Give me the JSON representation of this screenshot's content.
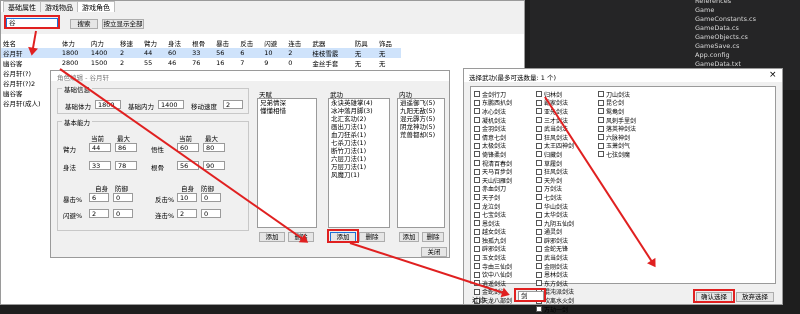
{
  "main": {
    "tabs": [
      "基础属性",
      "游戏物品",
      "游戏角色"
    ],
    "search_value": "谷",
    "search_button": "搜索",
    "show_all_button": "按立显示全部",
    "columns": [
      "姓名",
      "体力",
      "内力",
      "移速",
      "臂力",
      "身法",
      "根骨",
      "暴击",
      "反击",
      "闪避",
      "连击",
      "武器",
      "防具",
      "饰品"
    ],
    "rows": [
      [
        "谷月轩",
        "1800",
        "1400",
        "2",
        "44",
        "60",
        "33",
        "56",
        "6",
        "10",
        "2",
        "桂枝雪霰",
        "无",
        "无"
      ],
      [
        "幽谷客",
        "2800",
        "1500",
        "2",
        "55",
        "46",
        "76",
        "16",
        "7",
        "9",
        "0",
        "金丝手套",
        "无",
        "无"
      ],
      [
        "谷月轩(?)",
        "",
        "",
        "",
        "",
        "",
        "",
        "",
        "",
        "",
        "",
        "",
        "",
        ""
      ],
      [
        "谷月轩(?)2",
        "",
        "",
        "",
        "",
        "",
        "",
        "",
        "",
        "",
        "",
        "",
        "",
        ""
      ],
      [
        "幽谷客",
        "",
        "",
        "",
        "",
        "",
        "",
        "",
        "",
        "",
        "",
        "",
        "",
        ""
      ],
      [
        "谷月轩(成人)",
        "",
        "",
        "",
        "",
        "",
        "",
        "",
        "",
        "",
        "",
        "",
        "",
        ""
      ]
    ]
  },
  "role": {
    "title": "角色编辑 - 谷月轩",
    "basic_info": "基础信息",
    "hp_label": "基础体力",
    "hp": "1800",
    "mp_label": "基础内力",
    "mp": "1400",
    "speed_label": "移动速度",
    "speed": "2",
    "ability": "基本能力",
    "current": "当前",
    "max": "最大",
    "self": "自身",
    "bonus": "防御",
    "stats": [
      {
        "l": "臂力",
        "c": "44",
        "m": "86"
      },
      {
        "l": "悟性",
        "c": "60",
        "m": "80"
      },
      {
        "l": "身法",
        "c": "33",
        "m": "78"
      },
      {
        "l": "根骨",
        "c": "56",
        "m": "90"
      }
    ],
    "crit_label": "暴击%",
    "crit": "6",
    "crit2": "0",
    "counter_label": "反击%",
    "counter": "10",
    "counter2": "0",
    "dodge_label": "闪避%",
    "dodge": "2",
    "dodge2": "0",
    "combo_label": "连击%",
    "combo": "2",
    "combo2": "0",
    "talent_title": "天赋",
    "talents": [
      "兄弟情深",
      "懂懂相惜"
    ],
    "martial_title": "武功",
    "martials": [
      "永诀英雄掌(4)",
      "冰冲落月脚(3)",
      "北汇玄功(2)",
      "画出刀法(1)",
      "血刀狂杀(1)",
      "七杀刀法(1)",
      "断竹刀法(1)",
      "六层刀法(1)",
      "万层刀法(1)",
      "风魔刀(1)"
    ],
    "inner_title": "内功",
    "inners": [
      "逍遥御飞(5)",
      "九阳无敌(5)",
      "混元霹方(5)",
      "阴龙神功(5)",
      "荒兽都却(5)"
    ],
    "add": "添加",
    "delete": "删除",
    "close": "关闭"
  },
  "picker": {
    "title": "选择武功(最多可选数量: 1 个)",
    "close": "×",
    "col1": [
      "金剑行刀",
      "东鹏西扒剑",
      "冰心剑法",
      "凝机剑法",
      "金羽剑法",
      "倩意七剑",
      "太极剑法",
      "倚锋柔剑",
      "视清百春剑",
      "天马百步剑",
      "天山归雁剑",
      "赤血剑刀",
      "天子剑",
      "龙泣剑",
      "七宝剑法",
      "恩剑法",
      "越女剑法",
      "独孤九剑",
      "辟邪剑法",
      "玉女剑法",
      "寺由三仙剑",
      "饮中八仙剑",
      "逍遥剑法",
      "金蛇剑法",
      "天龙八部剑"
    ],
    "col2": [
      "归林剑",
      "霸家剑法",
      "亚先剑法",
      "三才剑法",
      "武当剑法",
      "狂风剑法",
      "太王四神剑",
      "归藏剑",
      "草履剑",
      "狂风剑法",
      "天外剑",
      "万剑法",
      "七剑法",
      "华山剑法",
      "太华剑法",
      "九阴五仙剑",
      "通灵剑",
      "辟邪剑法",
      "金蛇无锋",
      "武当剑法",
      "金刚剑法",
      "恩林剑法",
      "东方剑法",
      "混沌派剑法",
      "坎离水火剑",
      "万劫一剑"
    ],
    "col3": [
      "刀山剑法",
      "昆仑剑",
      "鸳鸯剑",
      "风刺手里剑",
      "落英神剑法",
      "六脉神剑",
      "玉萧剑气",
      "七弦剑魔"
    ],
    "filter_label": "过滤",
    "filter_value": "剑",
    "confirm": "确认选择",
    "cancel": "放弃选择"
  },
  "tree": [
    "References",
    "Game",
    "GameConstants.cs",
    "GameData.cs",
    "GameObjects.cs",
    "GameSave.cs",
    "App.config",
    "GameData.txt"
  ]
}
